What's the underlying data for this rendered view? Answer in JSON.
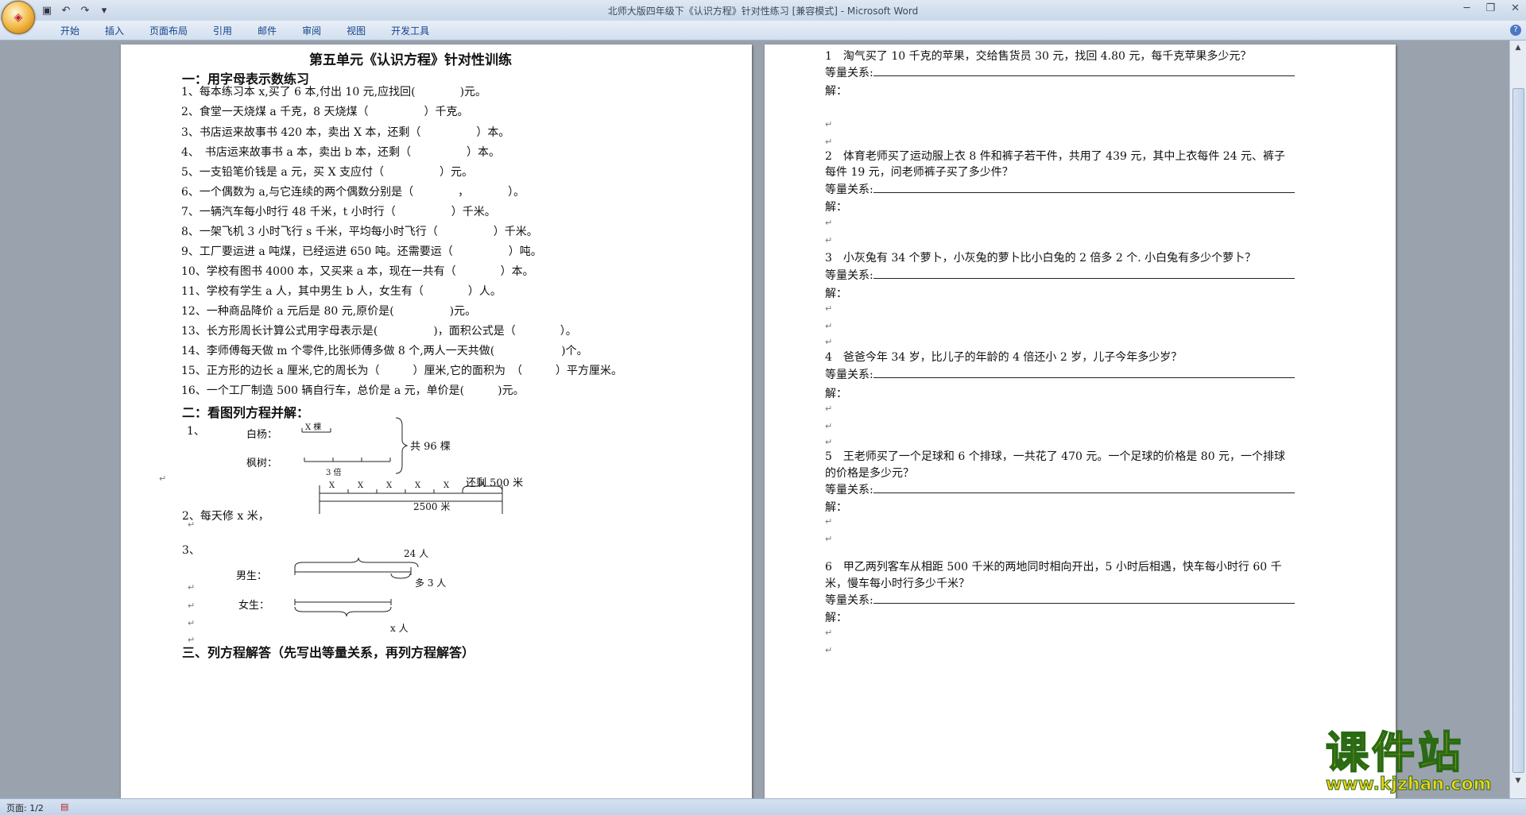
{
  "window": {
    "title": "北师大版四年级下《认识方程》针对性练习 [兼容模式] - Microsoft Word"
  },
  "ribbon": {
    "tabs": [
      "开始",
      "插入",
      "页面布局",
      "引用",
      "邮件",
      "审阅",
      "视图",
      "开发工具"
    ]
  },
  "status": {
    "page": "页面: 1/2"
  },
  "watermark": {
    "title": "课件站",
    "url": "www.kjzhan.com"
  },
  "page1": {
    "title": "第五单元《认识方程》针对性训练",
    "section1": "一：用字母表示数练习",
    "items": [
      "1、每本练习本 x,买了 6 本,付出 10 元,应找回(　　　　)元。",
      "2、食堂一天烧煤 a 千克，8 天烧煤（　　　　　）千克。",
      "3、书店运来故事书 420 本，卖出 X 本，还剩（　　　　　）本。",
      "4、　书店运来故事书 a 本，卖出 b 本，还剩（　　　　　）本。",
      "5、一支铅笔价钱是 a 元，买 X 支应付（　　　　　）元。",
      "6、一个偶数为 a,与它连续的两个偶数分别是（　　　　，　　　　）。",
      "7、一辆汽车每小时行 48 千米，t 小时行（　　　　　）千米。",
      "8、一架飞机 3 小时飞行 s 千米，平均每小时飞行（　　　　　）千米。",
      "9、工厂要运进 a 吨煤，已经运进 650 吨。还需要运（　　　　　）吨。",
      "10、学校有图书 4000 本，又买来 a 本，现在一共有（　　　　）本。",
      "11、学校有学生 a 人，其中男生 b 人，女生有（　　　　）人。",
      "12、一种商品降价 a 元后是 80 元,原价是(　　　　　)元。",
      "13、长方形周长计算公式用字母表示是(　　　　　)，面积公式是（　　　　）。",
      "14、李师傅每天做 m 个零件,比张师傅多做 8 个,两人一天共做(　　　　　　)个。",
      "15、正方形的边长 a 厘米,它的周长为（　　　）厘米,它的面积为　（　　　）平方厘米。",
      "16、一个工厂制造 500 辆自行车，总价是 a 元，单价是(　　　)元。"
    ],
    "section2": "二：看图列方程并解：",
    "fig1": {
      "num": "1、",
      "label_a": "白杨：",
      "label_b": "枫树：",
      "x_label": "X 棵",
      "times_label": "3 倍",
      "total": "共 96 棵"
    },
    "fig2": {
      "num": "2、每天修 x 米，",
      "x_marks": [
        "X",
        "X",
        "X",
        "X",
        "X"
      ],
      "remaining": "还剩 500 米",
      "total": "2500 米"
    },
    "fig3": {
      "num": "3、",
      "label_a": "男生：",
      "label_b": "女生：",
      "top": "24 人",
      "more": "多 3 人",
      "bottom": "x 人"
    },
    "section3": "三、列方程解答（先写出等量关系，再列方程解答）"
  },
  "page2": {
    "relation_label": "等量关系:",
    "solve_label": "解：",
    "problems": [
      {
        "line1": "1　淘气买了 10 千克的苹果，交给售货员 30 元，找回 4.80 元，每千克苹果多少元？",
        "line2": ""
      },
      {
        "line1": "2　体育老师买了运动服上衣 8 件和裤子若干件，共用了 439 元，其中上衣每件 24 元、裤子",
        "line2": "每件 19 元，问老师裤子买了多少件？"
      },
      {
        "line1": "3　小灰兔有 34 个萝卜，小灰兔的萝卜比小白兔的 2 倍多 2 个. 小白兔有多少个萝卜？",
        "line2": ""
      },
      {
        "line1": "4　爸爸今年 34 岁，比儿子的年龄的 4 倍还小 2 岁，儿子今年多少岁？",
        "line2": ""
      },
      {
        "line1": "5　王老师买了一个足球和 6 个排球，一共花了 470 元。一个足球的价格是 80 元，一个排球",
        "line2": "的价格是多少元？"
      },
      {
        "line1": "6　甲乙两列客车从相距 500 千米的两地同时相向开出，5 小时后相遇，快车每小时行 60 千",
        "line2": "米，慢车每小时行多少千米？"
      }
    ]
  }
}
